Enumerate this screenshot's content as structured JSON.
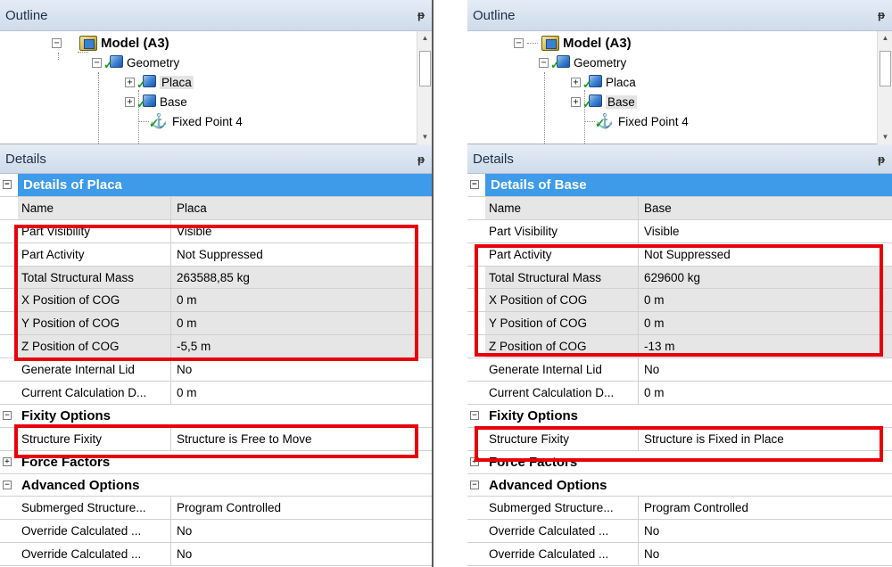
{
  "panels": [
    {
      "outline_title": "Outline",
      "details_title": "Details",
      "pin": "ᵽ",
      "tree": [
        {
          "label": "Model (A3)",
          "bold": true,
          "icon": "model-icon"
        },
        {
          "label": "Geometry",
          "icon": "geometry-icon"
        },
        {
          "label": "Placa",
          "icon": "part-icon",
          "selected": true
        },
        {
          "label": "Base",
          "icon": "part-icon"
        },
        {
          "label": "Fixed Point 4",
          "icon": "anchor-icon"
        }
      ],
      "details_header": "Details of Placa",
      "rows": [
        {
          "k": "Name",
          "v": "Placa",
          "shaded": true
        },
        {
          "k": "Part Visibility",
          "v": "Visible"
        },
        {
          "k": "Part Activity",
          "v": "Not Suppressed"
        },
        {
          "k": "Total Structural Mass",
          "v": "263588,85 kg",
          "shaded": true
        },
        {
          "k": "X Position of COG",
          "v": "0 m",
          "shaded": true
        },
        {
          "k": "Y Position of COG",
          "v": "0 m",
          "shaded": true
        },
        {
          "k": "Z Position of COG",
          "v": "-5,5 m",
          "shaded": true
        },
        {
          "k": "Generate Internal Lid",
          "v": "No"
        },
        {
          "k": "Current Calculation D...",
          "v": "0 m"
        }
      ],
      "group1": "Fixity Options",
      "fixity": {
        "k": "Structure Fixity",
        "v": "Structure is Free to Move"
      },
      "group2": "Force Factors",
      "group3": "Advanced Options",
      "adv_rows": [
        {
          "k": "Submerged Structure...",
          "v": "Program Controlled"
        },
        {
          "k": "Override Calculated ...",
          "v": "No"
        },
        {
          "k": "Override Calculated ...",
          "v": "No"
        }
      ]
    },
    {
      "outline_title": "Outline",
      "details_title": "Details",
      "pin": "ᵽ",
      "tree": [
        {
          "label": "Model (A3)",
          "bold": true,
          "icon": "model-icon"
        },
        {
          "label": "Geometry",
          "icon": "geometry-icon"
        },
        {
          "label": "Placa",
          "icon": "part-icon"
        },
        {
          "label": "Base",
          "icon": "part-icon",
          "selected": true
        },
        {
          "label": "Fixed Point 4",
          "icon": "anchor-icon"
        }
      ],
      "details_header": "Details of Base",
      "rows": [
        {
          "k": "Name",
          "v": "Base",
          "shaded": true
        },
        {
          "k": "Part Visibility",
          "v": "Visible"
        },
        {
          "k": "Part Activity",
          "v": "Not Suppressed"
        },
        {
          "k": "Total Structural Mass",
          "v": "629600 kg",
          "shaded": true
        },
        {
          "k": "X Position of COG",
          "v": "0 m",
          "shaded": true
        },
        {
          "k": "Y Position of COG",
          "v": "0 m",
          "shaded": true
        },
        {
          "k": "Z Position of COG",
          "v": "-13 m",
          "shaded": true
        },
        {
          "k": "Generate Internal Lid",
          "v": "No"
        },
        {
          "k": "Current Calculation D...",
          "v": "0 m"
        }
      ],
      "group1": "Fixity Options",
      "fixity": {
        "k": "Structure Fixity",
        "v": "Structure is Fixed in Place"
      },
      "group2": "Force Factors",
      "group3": "Advanced Options",
      "adv_rows": [
        {
          "k": "Submerged Structure...",
          "v": "Program Controlled"
        },
        {
          "k": "Override Calculated ...",
          "v": "No"
        },
        {
          "k": "Override Calculated ...",
          "v": "No"
        }
      ]
    }
  ],
  "colors": {
    "highlight": "#e8000b",
    "header_bg": "#3d9bea",
    "title_bar": "#cfdbea"
  }
}
